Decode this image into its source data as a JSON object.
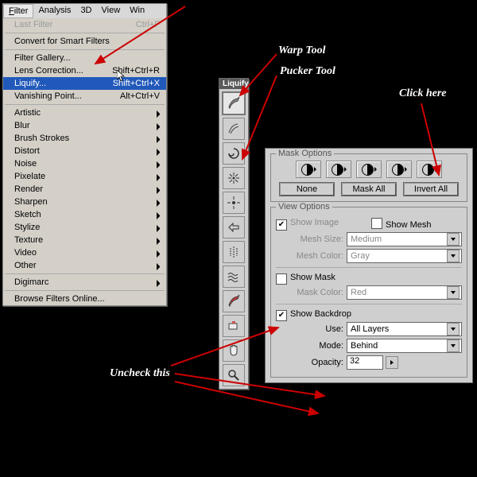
{
  "menubar": [
    "Filter",
    "Analysis",
    "3D",
    "View",
    "Win"
  ],
  "menu": {
    "last": {
      "label": "Last Filter",
      "short": "Ctrl+F"
    },
    "convert": "Convert for Smart Filters",
    "gallery": "Filter Gallery...",
    "lens": {
      "label": "Lens Correction...",
      "short": "Shift+Ctrl+R"
    },
    "liquify": {
      "label": "Liquify...",
      "short": "Shift+Ctrl+X"
    },
    "vanish": {
      "label": "Vanishing Point...",
      "short": "Alt+Ctrl+V"
    },
    "subs": [
      "Artistic",
      "Blur",
      "Brush Strokes",
      "Distort",
      "Noise",
      "Pixelate",
      "Render",
      "Sharpen",
      "Sketch",
      "Stylize",
      "Texture",
      "Video",
      "Other"
    ],
    "digimarc": "Digimarc",
    "browse": "Browse Filters Online..."
  },
  "palette_title": "Liquify",
  "tools": [
    "warp",
    "reconstruct",
    "swirl",
    "pucker",
    "bloat",
    "push",
    "mirror",
    "turbulence",
    "freeze",
    "thaw",
    "hand",
    "zoom"
  ],
  "mask": {
    "group": "Mask Options",
    "none": "None",
    "all": "Mask All",
    "invert": "Invert All"
  },
  "view": {
    "group": "View Options",
    "show_image": "Show Image",
    "show_mesh": "Show Mesh",
    "mesh_size_lab": "Mesh Size:",
    "mesh_size": "Medium",
    "mesh_color_lab": "Mesh Color:",
    "mesh_color": "Gray",
    "show_mask": "Show Mask",
    "mask_color_lab": "Mask Color:",
    "mask_color": "Red",
    "show_backdrop": "Show Backdrop",
    "use_lab": "Use:",
    "use": "All Layers",
    "mode_lab": "Mode:",
    "mode": "Behind",
    "opacity_lab": "Opacity:",
    "opacity": "32",
    "show_image_checked": true,
    "show_mesh_checked": false,
    "show_mask_checked": false,
    "show_backdrop_checked": true
  },
  "ann": {
    "warp": "Warp Tool",
    "pucker": "Pucker Tool",
    "click": "Click here",
    "uncheck": "Uncheck this"
  }
}
